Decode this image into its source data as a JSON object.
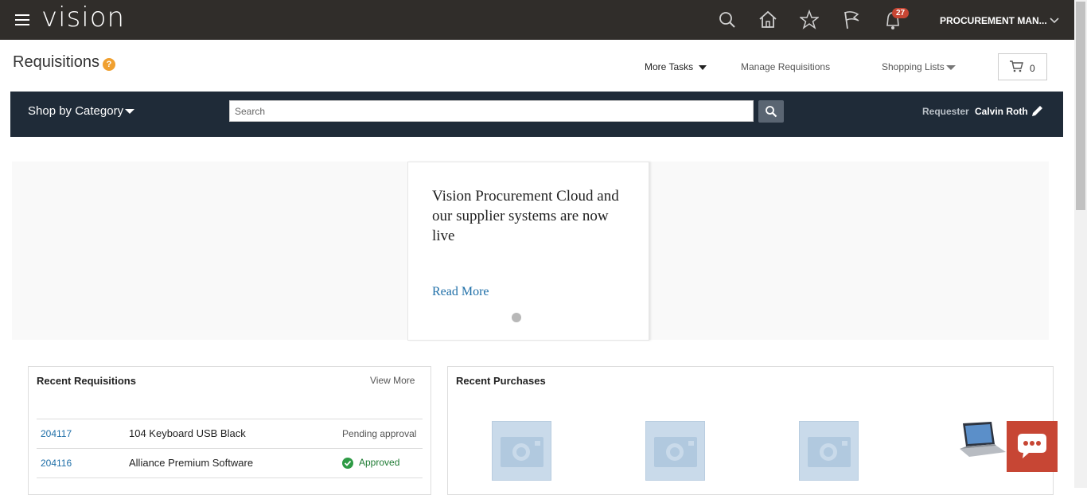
{
  "header": {
    "app_name": "vision",
    "notification_count": "27",
    "user_menu": "PROCUREMENT MAN...",
    "icons": [
      "menu-icon",
      "search-icon",
      "home-icon",
      "star-icon",
      "flag-icon",
      "bell-icon",
      "chevron-down-icon"
    ]
  },
  "page": {
    "title": "Requisitions",
    "help": "?"
  },
  "actions": {
    "more_tasks": "More Tasks",
    "manage_requisitions": "Manage Requisitions",
    "shopping_lists": "Shopping Lists",
    "cart_count": "0"
  },
  "shopbar": {
    "shop_by_category": "Shop by Category",
    "search_placeholder": "Search",
    "requester_label": "Requester",
    "requester_name": "Calvin Roth"
  },
  "banner": {
    "text": "Vision Procurement Cloud and our supplier systems are now live",
    "read_more": "Read More"
  },
  "recent_requisitions": {
    "title": "Recent Requisitions",
    "view_more": "View More",
    "rows": [
      {
        "number": "204117",
        "description": "104 Keyboard USB Black",
        "status": "Pending approval"
      },
      {
        "number": "204116",
        "description": "Alliance Premium Software",
        "status": "Approved"
      }
    ]
  },
  "recent_purchases": {
    "title": "Recent Purchases"
  },
  "colors": {
    "topbar": "#302d2a",
    "shopbar": "#1f2b38",
    "badge": "#c74634",
    "link": "#1f6fa8",
    "approved": "#1d7a32"
  }
}
